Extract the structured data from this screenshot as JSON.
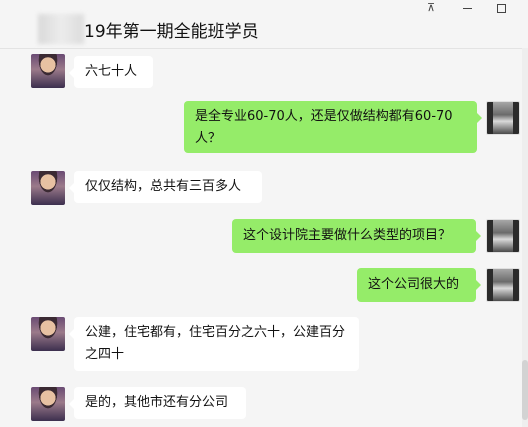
{
  "window": {
    "title": "19年第一期全能班学员",
    "pin_glyph": "⊼",
    "scroll_thumb_color": "#d3d3d3"
  },
  "messages": [
    {
      "side": "incoming",
      "text": "六七十人"
    },
    {
      "side": "outgoing",
      "text": "是全专业60-70人，还是仅做结构都有60-70人？"
    },
    {
      "side": "incoming",
      "text": "仅仅结构，总共有三百多人"
    },
    {
      "side": "outgoing",
      "text": "这个设计院主要做什么类型的项目？"
    },
    {
      "side": "outgoing",
      "text": "这个公司很大的"
    },
    {
      "side": "incoming",
      "text": "公建，住宅都有，住宅百分之六十，公建百分之四十"
    },
    {
      "side": "incoming",
      "text": "是的，其他市还有分公司"
    }
  ],
  "colors": {
    "outgoing_bubble": "#95ec69",
    "incoming_bubble": "#ffffff",
    "chat_background": "#f5f5f5"
  }
}
